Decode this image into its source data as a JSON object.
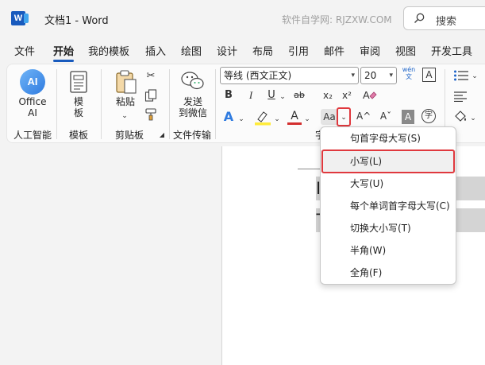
{
  "titlebar": {
    "doc_title": "文档1  -  Word",
    "watermark": "软件自学网: RJZXW.COM",
    "search_label": "搜索"
  },
  "tabs": [
    "文件",
    "开始",
    "我的模板",
    "插入",
    "绘图",
    "设计",
    "布局",
    "引用",
    "邮件",
    "审阅",
    "视图",
    "开发工具"
  ],
  "ribbon": {
    "ai_icon_text": "AI",
    "office_ai_label": "Office\nAI",
    "template_label": "模\n板",
    "paste_label": "粘贴",
    "send_label": "发送\n到微信",
    "groups": {
      "ai": "人工智能",
      "template": "模板",
      "clipboard": "剪贴板",
      "file_transfer": "文件传输",
      "font_partial": "字"
    },
    "font_name": "等线 (西文正文)",
    "font_size": "20",
    "wen_icon_text": "wén\n文",
    "a_box_text": "A",
    "bold": "B",
    "italic": "I",
    "underline": "U",
    "strike": "ab",
    "subscript": "x₂",
    "superscript": "x²",
    "change_case": "Aa",
    "grow_font": "A^",
    "shrink_font": "Aˇ",
    "char_shading": "A",
    "enclose_char": "字",
    "font_color_a": "A",
    "effects_a": "A"
  },
  "document": {
    "line1": "I        war",
    "line2": "T        et st"
  },
  "dropdown": {
    "items": [
      {
        "label": "句首字母大写(S)"
      },
      {
        "label": "小写(L)"
      },
      {
        "label": "大写(U)"
      },
      {
        "label": "每个单词首字母大写(C)"
      },
      {
        "label": "切换大小写(T)"
      },
      {
        "label": "半角(W)"
      },
      {
        "label": "全角(F)"
      }
    ]
  },
  "colors": {
    "accent": "#185abd",
    "highlight_red": "#e0393e",
    "font_color_red": "#d32f2f",
    "highlighter_yellow": "#ffeb3b"
  }
}
